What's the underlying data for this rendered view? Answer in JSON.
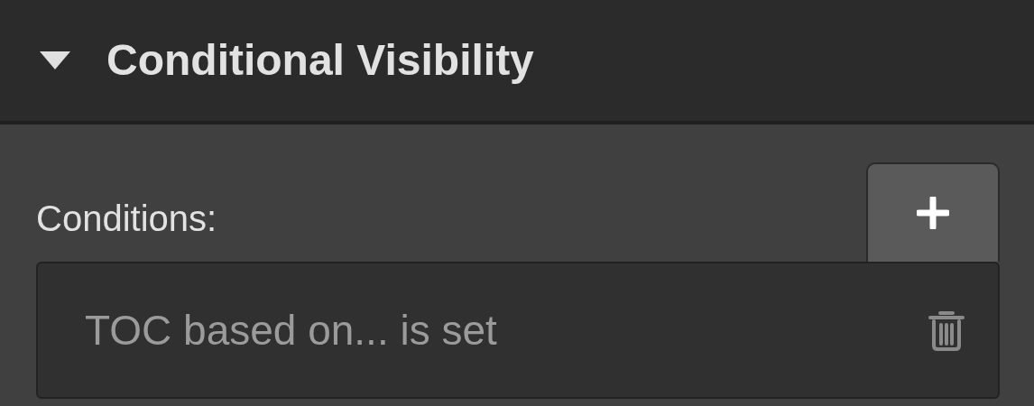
{
  "section": {
    "title": "Conditional Visibility",
    "expanded": true
  },
  "conditions": {
    "label": "Conditions:",
    "items": [
      {
        "text": "TOC based on... is set"
      }
    ]
  }
}
